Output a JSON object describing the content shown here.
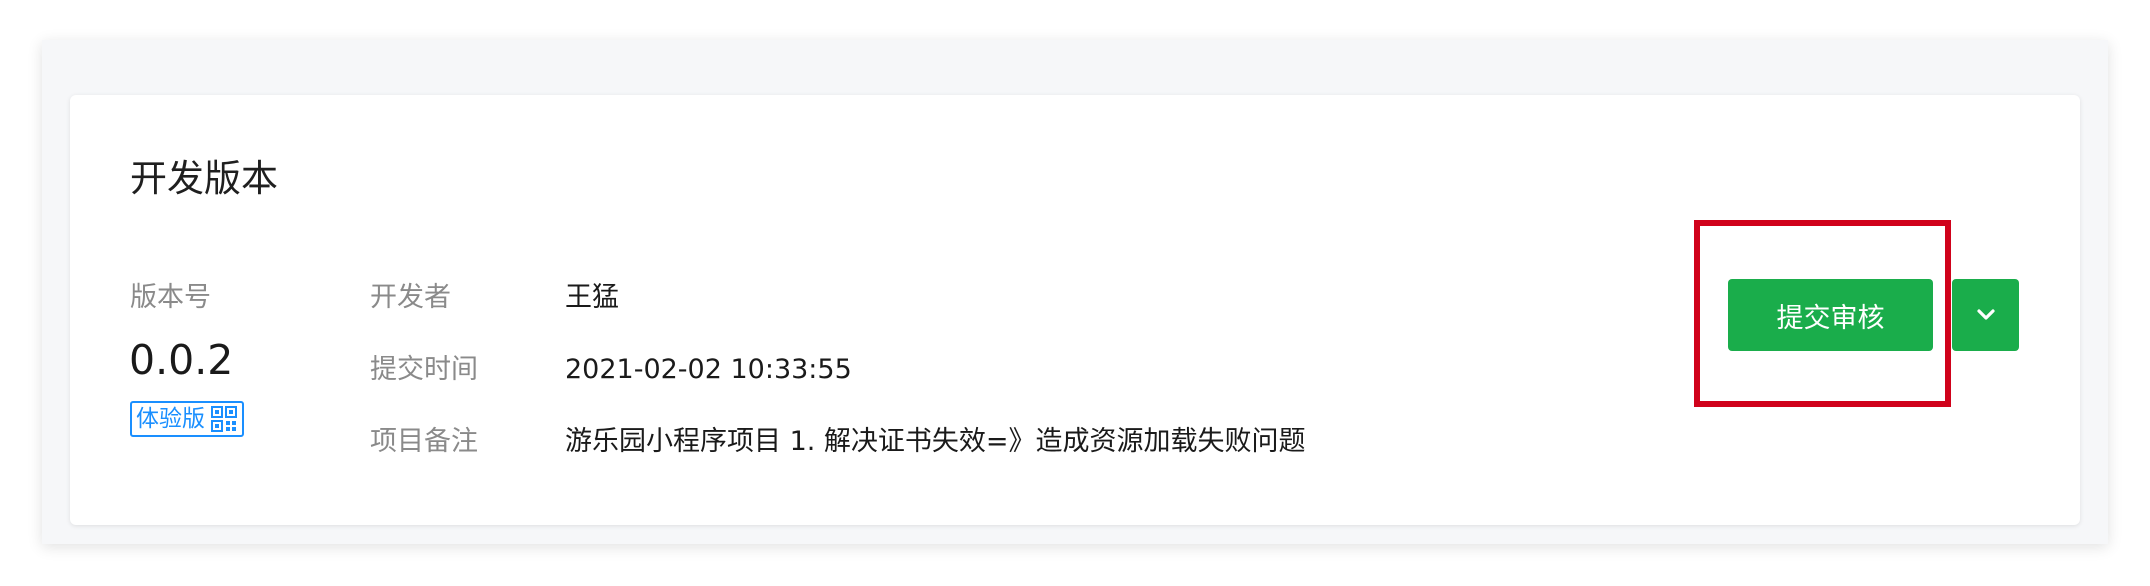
{
  "section": {
    "title": "开发版本"
  },
  "version": {
    "label": "版本号",
    "number": "0.0.2",
    "badge_label": "体验版",
    "badge_icon": "qr-code-icon"
  },
  "details": [
    {
      "label": "开发者",
      "value": "王猛"
    },
    {
      "label": "提交时间",
      "value": "2021-02-02 10:33:55"
    },
    {
      "label": "项目备注",
      "value": "游乐园小程序项目 1. 解决证书失效=》造成资源加载失败问题"
    }
  ],
  "actions": {
    "submit_label": "提交审核",
    "more_icon": "chevron-down-icon"
  },
  "colors": {
    "primary_green": "#1aad4b",
    "badge_blue": "#1a8fff",
    "highlight_red": "#d0021b",
    "muted_text": "#8a8a8a"
  }
}
